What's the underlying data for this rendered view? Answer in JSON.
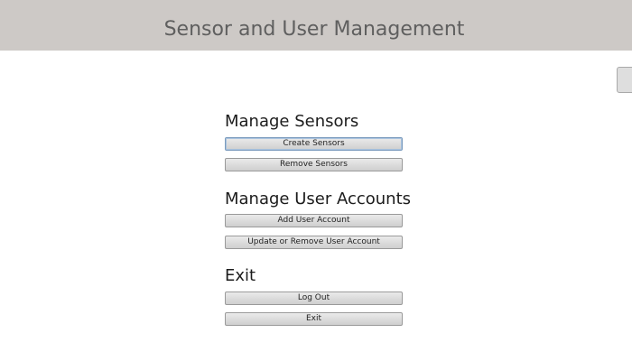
{
  "header": {
    "title": "Sensor and User Management"
  },
  "sections": [
    {
      "heading": "Manage Sensors",
      "buttons": [
        "Create Sensors",
        "Remove Sensors"
      ]
    },
    {
      "heading": "Manage User Accounts",
      "buttons": [
        "Add User Account",
        "Update or Remove User Account"
      ]
    },
    {
      "heading": "Exit",
      "buttons": [
        "Log Out",
        "Exit"
      ]
    }
  ],
  "colors": {
    "header_bg": "#cdc9c6",
    "title_text": "#5f5f5f",
    "focus_border": "#7b9bbd"
  }
}
